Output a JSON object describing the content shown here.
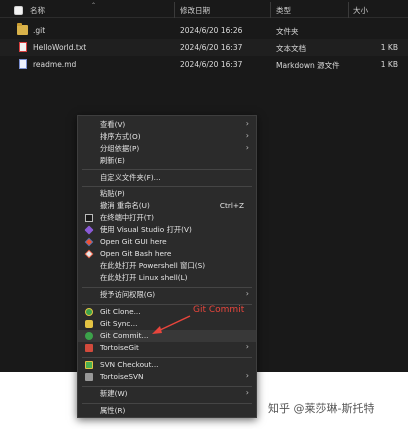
{
  "header": {
    "name": "名称",
    "modified": "修改日期",
    "type": "类型",
    "size": "大小"
  },
  "files": [
    {
      "name": ".git",
      "modified": "2024/6/20 16:26",
      "type": "文件夹",
      "size": ""
    },
    {
      "name": "HelloWorld.txt",
      "modified": "2024/6/20 16:37",
      "type": "文本文档",
      "size": "1 KB"
    },
    {
      "name": "readme.md",
      "modified": "2024/6/20 16:37",
      "type": "Markdown 源文件",
      "size": "1 KB"
    }
  ],
  "menu": {
    "view": "查看(V)",
    "sort": "排序方式(O)",
    "group": "分组依据(P)",
    "refresh": "刷新(E)",
    "customize": "自定义文件夹(F)...",
    "paste": "粘贴(P)",
    "undo": "撤消 重命名(U)",
    "undo_shortcut": "Ctrl+Z",
    "terminal": "在终端中打开(T)",
    "vs": "使用 Visual Studio 打开(V)",
    "git_gui": "Open Git GUI here",
    "git_bash": "Open Git Bash here",
    "powershell": "在此处打开 Powershell 窗口(S)",
    "linux": "在此处打开 Linux shell(L)",
    "access": "授予访问权限(G)",
    "git_clone": "Git Clone...",
    "git_sync": "Git Sync...",
    "git_commit": "Git Commit...",
    "tortoise_git": "TortoiseGit",
    "svn_checkout": "SVN Checkout...",
    "tortoise_svn": "TortoiseSVN",
    "new": "新建(W)",
    "properties": "属性(R)"
  },
  "annotation": "Git Commit",
  "watermark": "知乎 @莱莎琳-斯托特",
  "colors": {
    "background": "#191919",
    "menu_bg": "#2b2b2b",
    "annotation": "#e8453c"
  }
}
